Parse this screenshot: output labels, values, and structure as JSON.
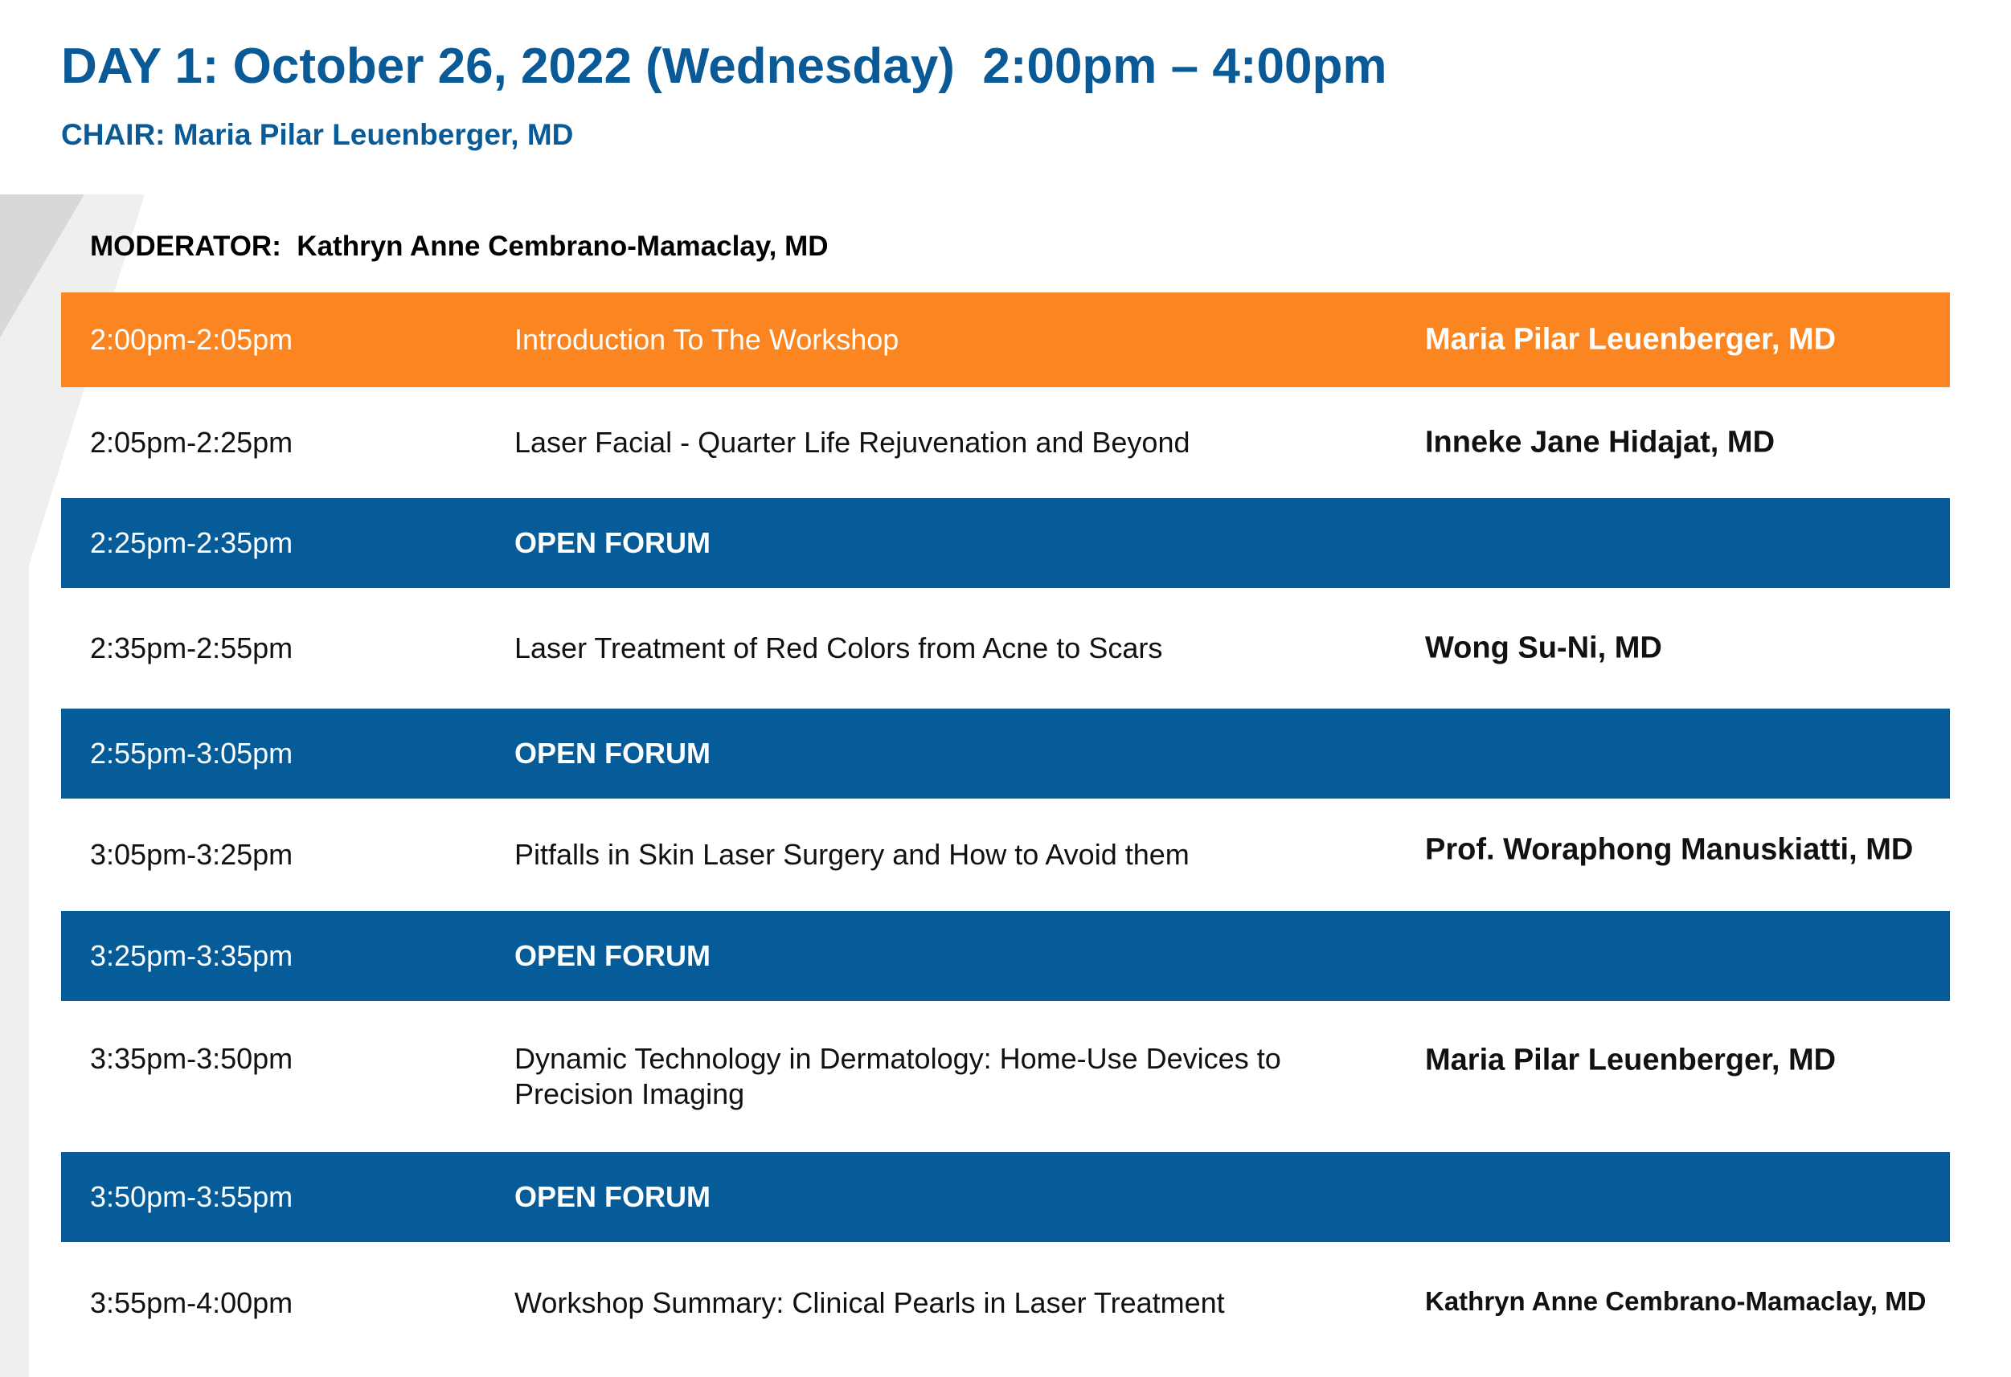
{
  "header": {
    "title": "DAY 1: October 26, 2022 (Wednesday)  2:00pm – 4:00pm",
    "chair": "CHAIR: Maria Pilar Leuenberger, MD"
  },
  "moderator": "MODERATOR:  Kathryn Anne Cembrano-Mamaclay, MD",
  "colors": {
    "title_blue": "#0a5a97",
    "highlight_orange": "#fb8520",
    "forum_blue": "#065c98"
  },
  "schedule": [
    {
      "time": "2:00pm-2:05pm",
      "topic": "Introduction To The Workshop",
      "speaker": "Maria Pilar Leuenberger, MD"
    },
    {
      "time": "2:05pm-2:25pm",
      "topic": "Laser Facial - Quarter Life Rejuvenation and Beyond",
      "speaker": "Inneke Jane Hidajat, MD"
    },
    {
      "time": "2:25pm-2:35pm",
      "topic": "OPEN FORUM",
      "speaker": ""
    },
    {
      "time": "2:35pm-2:55pm",
      "topic": "Laser Treatment of Red Colors from Acne to Scars",
      "speaker": "Wong Su-Ni, MD"
    },
    {
      "time": "2:55pm-3:05pm",
      "topic": "OPEN FORUM",
      "speaker": ""
    },
    {
      "time": "3:05pm-3:25pm",
      "topic": "Pitfalls in Skin Laser Surgery and How to Avoid them",
      "speaker": "Prof. Woraphong Manuskiatti, MD"
    },
    {
      "time": "3:25pm-3:35pm",
      "topic": "OPEN FORUM",
      "speaker": ""
    },
    {
      "time": "3:35pm-3:50pm",
      "topic": "Dynamic Technology in Dermatology: Home-Use Devices to Precision Imaging",
      "speaker": "Maria Pilar Leuenberger, MD"
    },
    {
      "time": "3:50pm-3:55pm",
      "topic": "OPEN FORUM",
      "speaker": ""
    },
    {
      "time": "3:55pm-4:00pm",
      "topic": "Workshop Summary: Clinical Pearls in Laser Treatment",
      "speaker": "Kathryn Anne Cembrano-Mamaclay, MD"
    }
  ]
}
